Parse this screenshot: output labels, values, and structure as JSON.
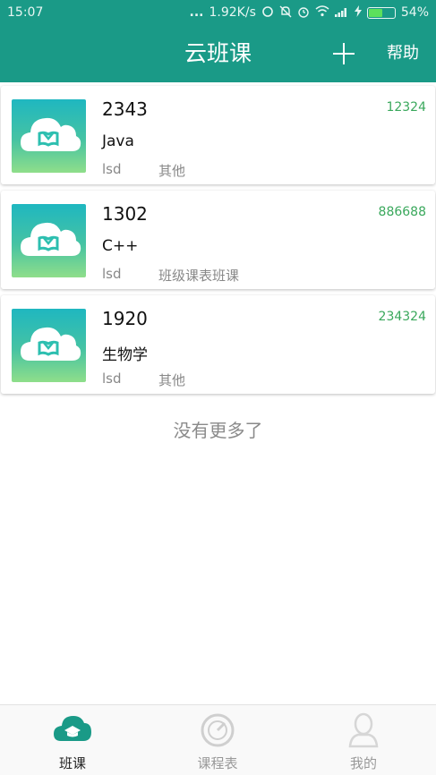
{
  "status_bar": {
    "time": "15:07",
    "dots": "...",
    "speed": "1.92K/s",
    "battery_level": 0.54,
    "battery_text": "54%",
    "icons": [
      "sync-icon",
      "mute-bell-icon",
      "alarm-icon",
      "wifi-icon",
      "signal-icon",
      "charging-icon",
      "battery-icon"
    ]
  },
  "header": {
    "title": "云班课",
    "add_icon": "plus-icon",
    "help_label": "帮助"
  },
  "courses": [
    {
      "name": "2343",
      "subject": "Java",
      "teacher": "lsd",
      "tag": "其他",
      "code": "12324"
    },
    {
      "name": "1302",
      "subject": "C++",
      "teacher": "lsd",
      "tag": "班级课表班课",
      "code": "886688"
    },
    {
      "name": "1920",
      "subject": "生物学",
      "teacher": "lsd",
      "tag": "其他",
      "code": "234324"
    }
  ],
  "list_footer": "没有更多了",
  "bottom_nav": {
    "items": [
      {
        "label": "班课",
        "icon": "cloud-class-icon",
        "active": true
      },
      {
        "label": "课程表",
        "icon": "dial-icon",
        "active": false
      },
      {
        "label": "我的",
        "icon": "user-icon",
        "active": false
      }
    ]
  },
  "colors": {
    "primary": "#1a9a87",
    "code_green": "#3aa85c",
    "battery_green": "#5ce05c"
  }
}
